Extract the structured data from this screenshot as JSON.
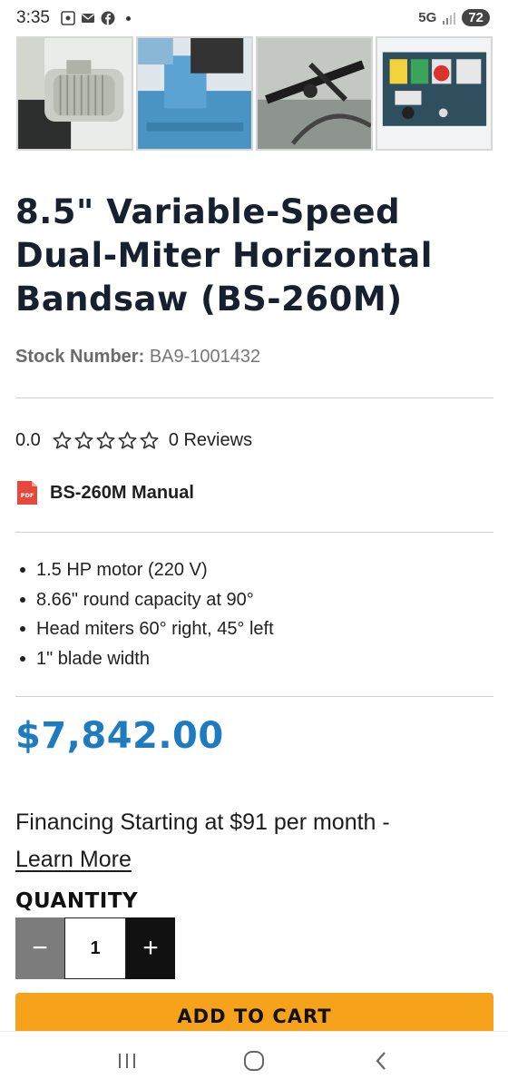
{
  "status_bar": {
    "time": "3:35",
    "network": "5G",
    "battery": "72"
  },
  "product": {
    "title": "8.5\" Variable-Speed Dual-Miter Horizontal Bandsaw (BS-260M)",
    "stock_label": "Stock Number:",
    "stock_number": "BA9-1001432",
    "rating_value": "0.0",
    "rating_stars": 0,
    "reviews": "0 Reviews",
    "manual": "BS-260M Manual",
    "pdf_badge": "PDF",
    "features": [
      "1.5 HP motor (220 V)",
      "8.66\" round capacity at 90°",
      "Head miters 60° right, 45° left",
      "1\" blade width"
    ],
    "price": "$7,842.00",
    "financing_text": "Financing Starting at $91 per month -",
    "learn_more": "Learn More"
  },
  "purchase": {
    "quantity_label": "QUANTITY",
    "quantity": "1",
    "minus": "−",
    "plus": "+",
    "add_to_cart": "ADD TO CART"
  },
  "icons": {
    "star": "star-outline-icon",
    "pdf": "pdf-file-icon"
  },
  "colors": {
    "price": "#1e7bbf",
    "cta": "#f6a21b",
    "title": "#16202e"
  }
}
